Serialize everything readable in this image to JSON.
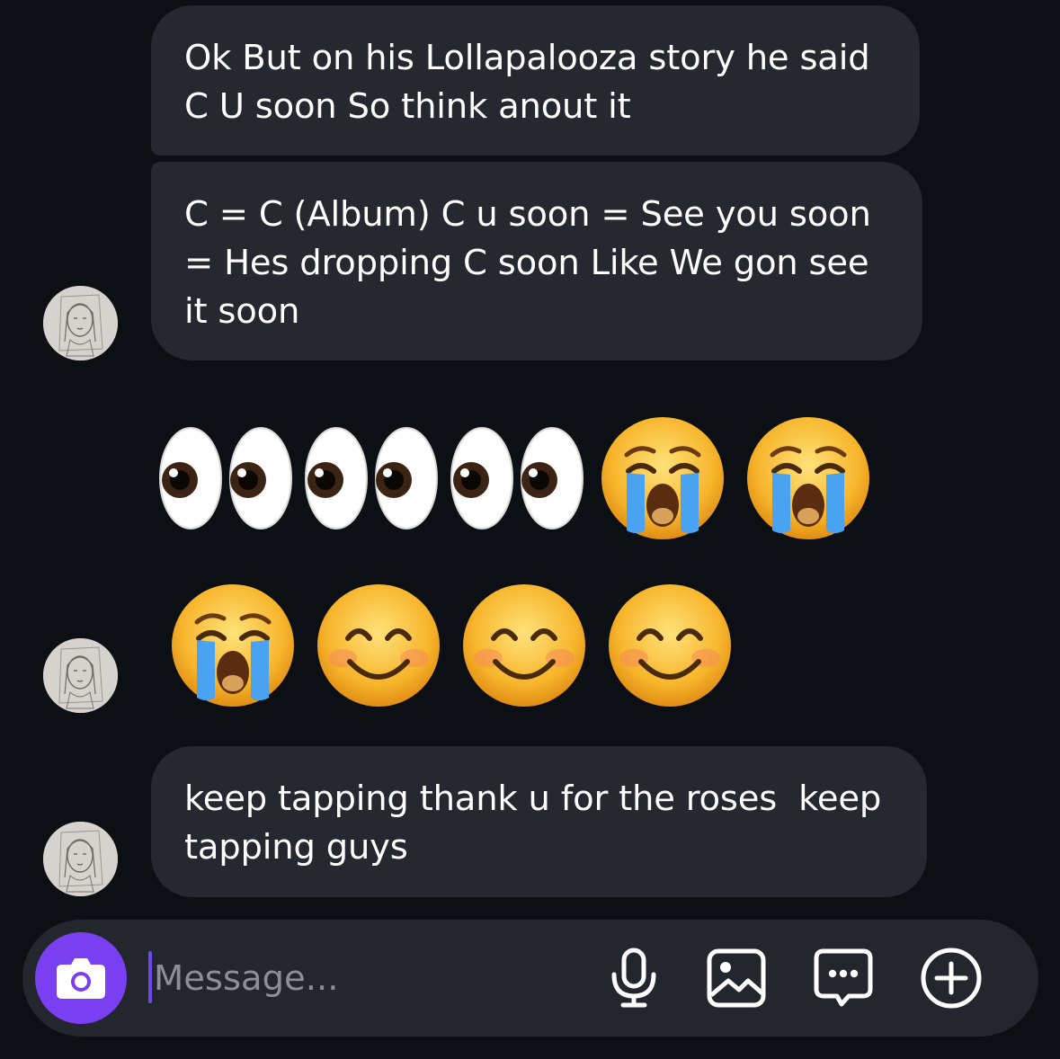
{
  "messages": [
    {
      "text": "Ok But on his Lollapalooza story he said\nC U soon So think anout it"
    },
    {
      "text": "C = C (Album) C u soon = See you soon\n= Hes dropping C soon Like We gon see\nit soon"
    },
    {
      "emoji_row_1": [
        "eyes",
        "eyes",
        "eyes",
        "loudly-crying-face",
        "loudly-crying-face"
      ]
    },
    {
      "emoji_row_2": [
        "loudly-crying-face",
        "smiling-face-with-smiling-eyes",
        "smiling-face-with-smiling-eyes",
        "smiling-face-with-smiling-eyes"
      ]
    },
    {
      "text": "keep tapping thank u for the roses  keep\ntapping guys"
    }
  ],
  "bubble_1": "Ok But on his Lollapalooza story he said\nC U soon So think anout it",
  "bubble_2": "C = C (Album) C u soon = See you soon\n= Hes dropping C soon Like We gon see\nit soon",
  "bubble_3": "keep tapping thank u for the roses  keep\ntapping guys",
  "composer": {
    "placeholder": "Message...",
    "icons": [
      "camera-icon",
      "microphone-icon",
      "gallery-icon",
      "sticker-icon",
      "plus-circle-icon"
    ]
  },
  "colors": {
    "background": "#0c0f14",
    "bubble": "#25282e",
    "composer": "#23262d",
    "accent": "#7b3ff2"
  }
}
